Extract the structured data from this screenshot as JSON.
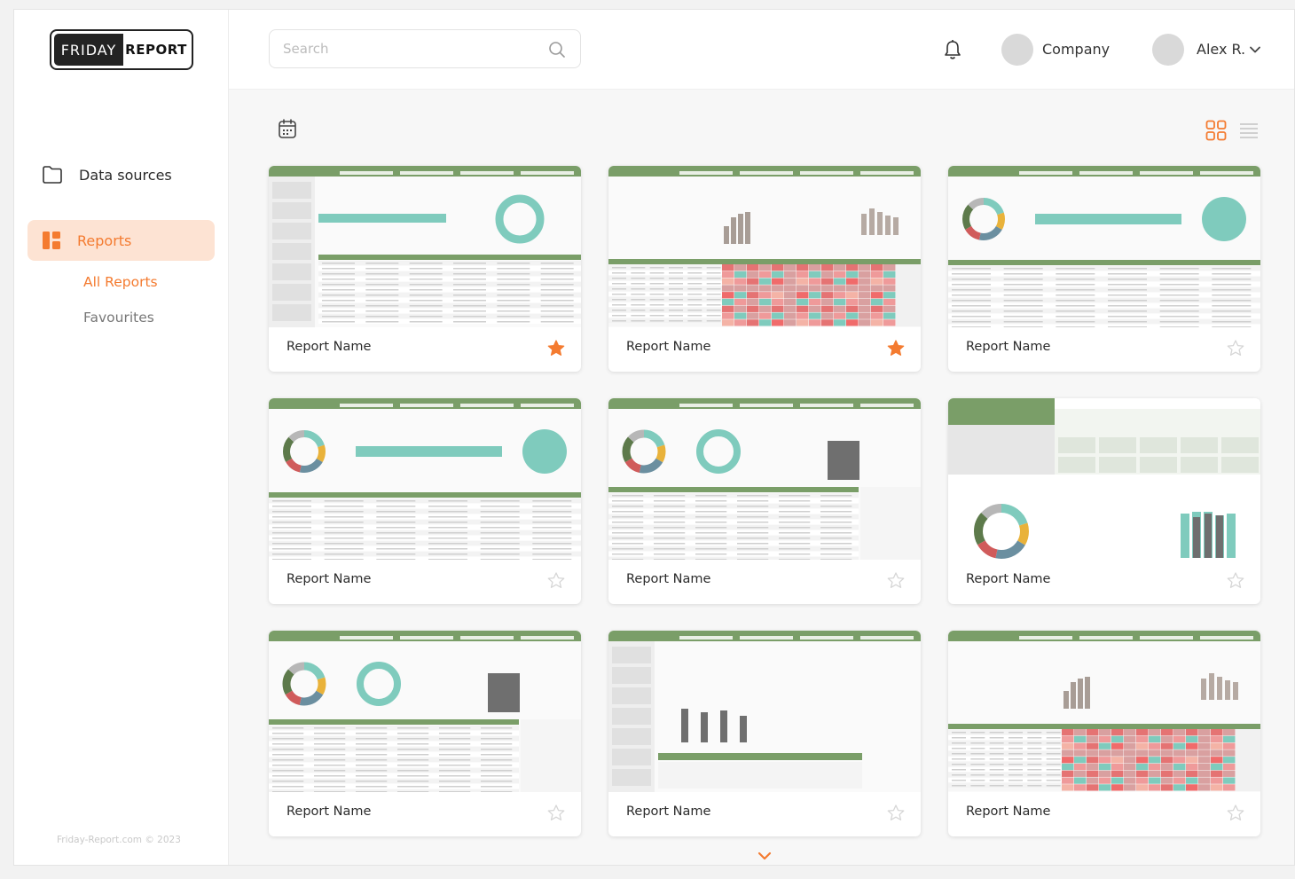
{
  "brand": {
    "logo_left": "FRIDAY",
    "logo_right": "REPORT"
  },
  "sidebar": {
    "items": [
      {
        "label": "Data sources",
        "icon": "folder-icon"
      },
      {
        "label": "Reports",
        "icon": "reports-icon",
        "active": true
      }
    ],
    "sub_items": [
      {
        "label": "All Reports",
        "active": true
      },
      {
        "label": "Favourites"
      }
    ],
    "copyright": "Friday-Report.com © 2023"
  },
  "header": {
    "search_placeholder": "Search",
    "company": "Company",
    "user": "Alex R."
  },
  "reports": [
    {
      "name": "Report Name",
      "favourite": true
    },
    {
      "name": "Report Name",
      "favourite": true
    },
    {
      "name": "Report Name",
      "favourite": false
    },
    {
      "name": "Report Name",
      "favourite": false
    },
    {
      "name": "Report Name",
      "favourite": false
    },
    {
      "name": "Report Name",
      "favourite": false
    },
    {
      "name": "Report Name",
      "favourite": false
    },
    {
      "name": "Report Name",
      "favourite": false
    },
    {
      "name": "Report Name",
      "favourite": false
    }
  ],
  "colors": {
    "accent": "#f47b30",
    "accent_light": "#fde3d3",
    "thumb_green": "#7a9e68",
    "thumb_teal": "#7fcbbd",
    "star_empty": "#d6d6d6"
  }
}
